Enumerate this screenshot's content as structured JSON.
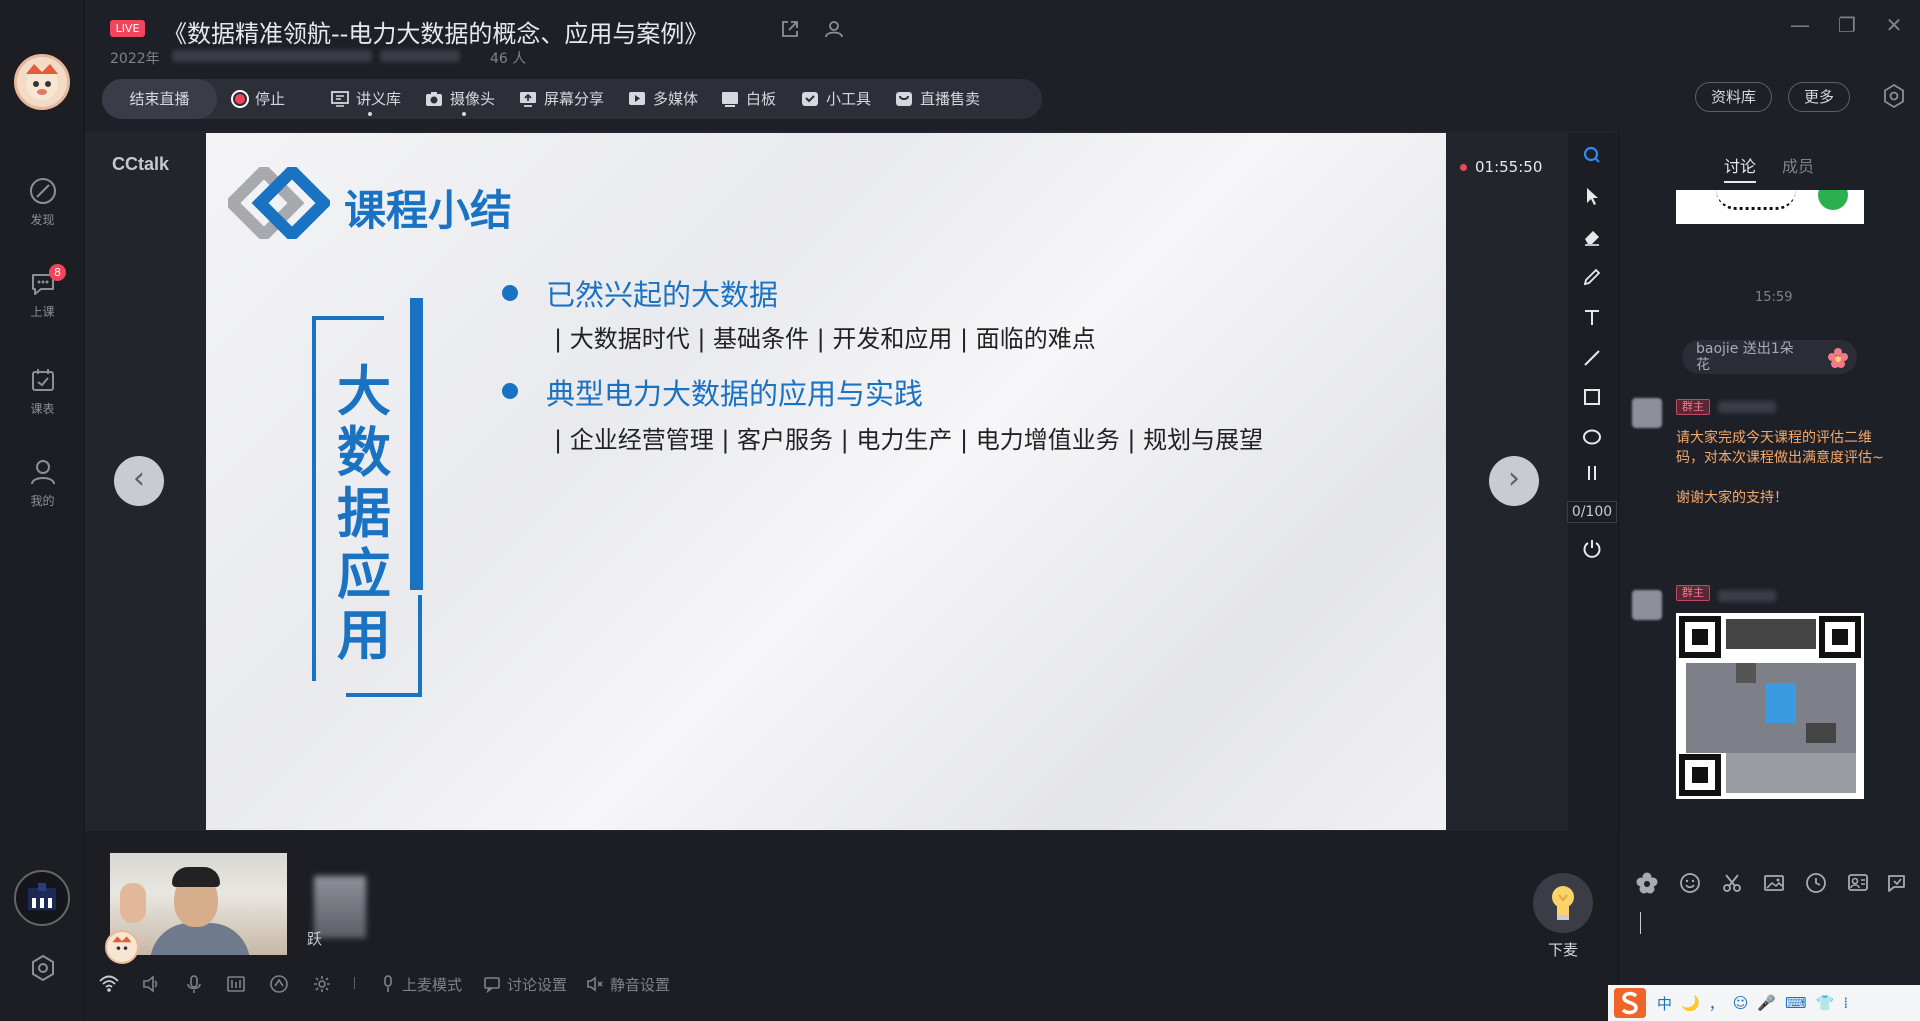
{
  "window": {
    "live_badge": "LIVE",
    "title": "《数据精准领航--电力大数据的概念、应用与案例》",
    "date_prefix": "2022年",
    "viewers": "46 人"
  },
  "toolbar": {
    "end_live": "结束直播",
    "stop": "停止",
    "lectures": "讲义库",
    "camera": "摄像头",
    "screen_share": "屏幕分享",
    "media": "多媒体",
    "whiteboard": "白板",
    "tools": "小工具",
    "sales": "直播售卖",
    "library": "资料库",
    "more": "更多"
  },
  "sidebar": {
    "items": [
      {
        "label": "发现",
        "icon": "compass-icon"
      },
      {
        "label": "上课",
        "icon": "chat-icon",
        "badge": "8"
      },
      {
        "label": "课表",
        "icon": "calendar-icon"
      },
      {
        "label": "我的",
        "icon": "user-icon"
      }
    ]
  },
  "stage": {
    "brand": "CCtalk",
    "timer": "01:55:50"
  },
  "slide": {
    "title": "课程小结",
    "vertical_title": "大数据应用",
    "points": [
      {
        "heading": "已然兴起的大数据",
        "detail": "| 大数据时代 | 基础条件 | 开发和应用 | 面临的难点"
      },
      {
        "heading": "典型电力大数据的应用与实践",
        "detail": "| 企业经营管理 | 客户服务 | 电力生产 | 电力增值业务 | 规划与展望"
      }
    ]
  },
  "draw_tools": {
    "items": [
      "zoom-icon",
      "pointer-icon",
      "eraser-icon",
      "pen-icon",
      "text-icon",
      "line-icon",
      "rectangle-icon",
      "ellipse-icon",
      "pause-icon",
      "power-icon"
    ],
    "page_count": "0/100"
  },
  "chat": {
    "tabs": [
      "讨论",
      "成员"
    ],
    "time": "15:59",
    "gift_text": "baojie 送出1朵花",
    "role_badge": "群主",
    "message": "请大家完成今天课程的评估二维码，对本次课程做出满意度评估~",
    "message2": "谢谢大家的支持！"
  },
  "bottom": {
    "speaker_label": "跃",
    "mode": "上麦模式",
    "discuss_settings": "讨论设置",
    "mute_settings": "静音设置",
    "mic_off": "下麦"
  },
  "ime": {
    "items": [
      "中",
      "🌙",
      "，",
      "☺",
      "🎤",
      "⌨",
      "👕",
      "⁞"
    ]
  },
  "colors": {
    "accent": "#1a72c2",
    "live": "#f0455c",
    "background": "#1e2027"
  }
}
